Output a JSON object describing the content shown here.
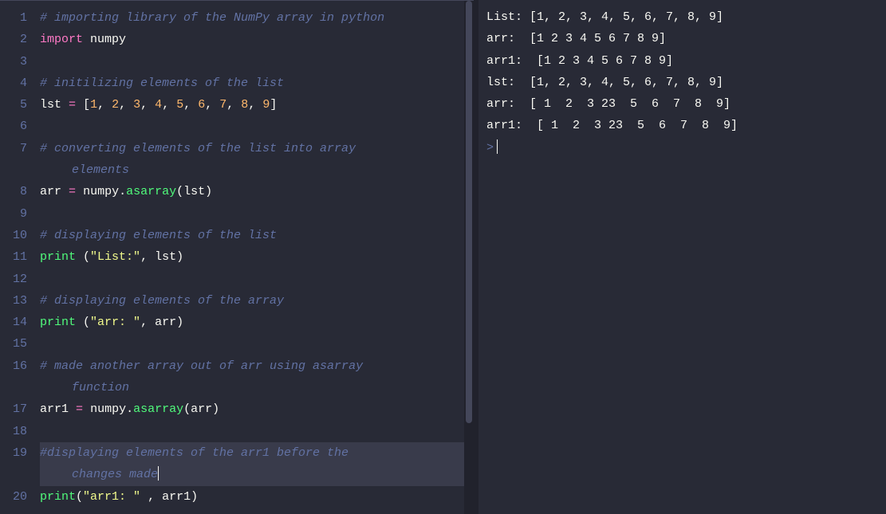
{
  "editor": {
    "lines": [
      {
        "n": 1,
        "type": "code",
        "tokens": [
          [
            "comment",
            "# importing library of the NumPy array in python"
          ]
        ]
      },
      {
        "n": 2,
        "type": "code",
        "tokens": [
          [
            "keyword",
            "import"
          ],
          [
            "space",
            " "
          ],
          [
            "module",
            "numpy"
          ]
        ]
      },
      {
        "n": 3,
        "type": "blank"
      },
      {
        "n": 4,
        "type": "code",
        "tokens": [
          [
            "comment",
            "# initilizing elements of the list"
          ]
        ]
      },
      {
        "n": 5,
        "type": "code",
        "tokens": [
          [
            "ident",
            "lst"
          ],
          [
            "space",
            " "
          ],
          [
            "op",
            "="
          ],
          [
            "space",
            " "
          ],
          [
            "punct",
            "["
          ],
          [
            "number",
            "1"
          ],
          [
            "punct",
            ", "
          ],
          [
            "number",
            "2"
          ],
          [
            "punct",
            ", "
          ],
          [
            "number",
            "3"
          ],
          [
            "punct",
            ", "
          ],
          [
            "number",
            "4"
          ],
          [
            "punct",
            ", "
          ],
          [
            "number",
            "5"
          ],
          [
            "punct",
            ", "
          ],
          [
            "number",
            "6"
          ],
          [
            "punct",
            ", "
          ],
          [
            "number",
            "7"
          ],
          [
            "punct",
            ", "
          ],
          [
            "number",
            "8"
          ],
          [
            "punct",
            ", "
          ],
          [
            "number",
            "9"
          ],
          [
            "punct",
            "]"
          ]
        ]
      },
      {
        "n": 6,
        "type": "blank"
      },
      {
        "n": 7,
        "type": "wrap",
        "first": [
          [
            "comment",
            "# converting elements of the list into array "
          ]
        ],
        "cont": [
          [
            "comment",
            "elements"
          ]
        ]
      },
      {
        "n": 8,
        "type": "code",
        "tokens": [
          [
            "ident",
            "arr"
          ],
          [
            "space",
            " "
          ],
          [
            "op",
            "="
          ],
          [
            "space",
            " "
          ],
          [
            "ident",
            "numpy"
          ],
          [
            "punct",
            "."
          ],
          [
            "func",
            "asarray"
          ],
          [
            "punct",
            "("
          ],
          [
            "ident",
            "lst"
          ],
          [
            "punct",
            ")"
          ]
        ]
      },
      {
        "n": 9,
        "type": "blank"
      },
      {
        "n": 10,
        "type": "code",
        "tokens": [
          [
            "comment",
            "# displaying elements of the list"
          ]
        ]
      },
      {
        "n": 11,
        "type": "code",
        "tokens": [
          [
            "func",
            "print"
          ],
          [
            "space",
            " "
          ],
          [
            "punct",
            "("
          ],
          [
            "string",
            "\"List:\""
          ],
          [
            "punct",
            ", "
          ],
          [
            "ident",
            "lst"
          ],
          [
            "punct",
            ")"
          ]
        ]
      },
      {
        "n": 12,
        "type": "blank"
      },
      {
        "n": 13,
        "type": "code",
        "tokens": [
          [
            "comment",
            "# displaying elements of the array"
          ]
        ]
      },
      {
        "n": 14,
        "type": "code",
        "tokens": [
          [
            "func",
            "print"
          ],
          [
            "space",
            " "
          ],
          [
            "punct",
            "("
          ],
          [
            "string",
            "\"arr: \""
          ],
          [
            "punct",
            ", "
          ],
          [
            "ident",
            "arr"
          ],
          [
            "punct",
            ")"
          ]
        ]
      },
      {
        "n": 15,
        "type": "blank"
      },
      {
        "n": 16,
        "type": "wrap",
        "first": [
          [
            "comment",
            "# made another array out of arr using asarray "
          ]
        ],
        "cont": [
          [
            "comment",
            "function"
          ]
        ]
      },
      {
        "n": 17,
        "type": "code",
        "tokens": [
          [
            "ident",
            "arr1"
          ],
          [
            "space",
            " "
          ],
          [
            "op",
            "="
          ],
          [
            "space",
            " "
          ],
          [
            "ident",
            "numpy"
          ],
          [
            "punct",
            "."
          ],
          [
            "func",
            "asarray"
          ],
          [
            "punct",
            "("
          ],
          [
            "ident",
            "arr"
          ],
          [
            "punct",
            ")"
          ]
        ]
      },
      {
        "n": 18,
        "type": "blank"
      },
      {
        "n": 19,
        "type": "wrap",
        "selected": true,
        "cursor": true,
        "first": [
          [
            "comment",
            "#displaying elements of the arr1 before the "
          ]
        ],
        "cont": [
          [
            "comment",
            "changes made"
          ]
        ]
      },
      {
        "n": 20,
        "type": "code",
        "tokens": [
          [
            "func",
            "print"
          ],
          [
            "punct",
            "("
          ],
          [
            "string",
            "\"arr1: \""
          ],
          [
            "space",
            " "
          ],
          [
            "punct",
            ", "
          ],
          [
            "ident",
            "arr1"
          ],
          [
            "punct",
            ")"
          ]
        ]
      }
    ]
  },
  "output": {
    "lines": [
      "List: [1, 2, 3, 4, 5, 6, 7, 8, 9]",
      "arr:  [1 2 3 4 5 6 7 8 9]",
      "arr1:  [1 2 3 4 5 6 7 8 9]",
      "lst:  [1, 2, 3, 4, 5, 6, 7, 8, 9]",
      "arr:  [ 1  2  3 23  5  6  7  8  9]",
      "arr1:  [ 1  2  3 23  5  6  7  8  9]"
    ],
    "prompt": ">"
  }
}
